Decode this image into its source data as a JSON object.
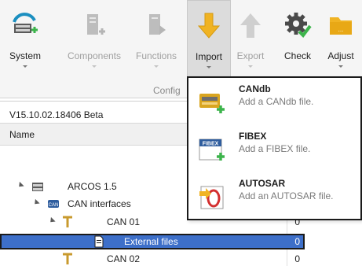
{
  "ribbon": {
    "buttons": [
      {
        "label": "System",
        "icon": "system-icon",
        "disabled": false
      },
      {
        "label": "Components",
        "icon": "components-icon",
        "disabled": true
      },
      {
        "label": "Functions",
        "icon": "functions-icon",
        "disabled": true
      },
      {
        "label": "Import",
        "icon": "import-arrow-icon",
        "disabled": false
      },
      {
        "label": "Export",
        "icon": "export-arrow-icon",
        "disabled": true
      },
      {
        "label": "Check",
        "icon": "check-gear-icon",
        "disabled": false
      },
      {
        "label": "Adjust",
        "icon": "adjust-folder-icon",
        "disabled": false
      }
    ],
    "group_label": "Config"
  },
  "panel": {
    "version": "V15.10.02.18406 Beta",
    "column_header": "Name"
  },
  "tree": [
    {
      "label": "ARCOS 1.5",
      "value": "",
      "icon": "server-icon"
    },
    {
      "label": "CAN interfaces",
      "value": "",
      "icon": "can-icon"
    },
    {
      "label": "CAN 01",
      "value": "0",
      "icon": "bus-icon"
    },
    {
      "label": "External files",
      "value": "0",
      "icon": "file-icon"
    },
    {
      "label": "CAN 02",
      "value": "0",
      "icon": "bus-icon"
    }
  ],
  "import_menu": {
    "items": [
      {
        "title": "CANdb",
        "description": "Add a CANdb file.",
        "icon": "candb-icon"
      },
      {
        "title": "FIBEX",
        "description": "Add a FIBEX file.",
        "icon": "fibex-icon"
      },
      {
        "title": "AUTOSAR",
        "description": "Add an AUTOSAR file.",
        "icon": "autosar-icon"
      }
    ],
    "fibex_badge": "FIBEX"
  },
  "colors": {
    "selection": "#3d6fc9",
    "import_accent": "#f0b323",
    "add_plus": "#3cb44b"
  }
}
